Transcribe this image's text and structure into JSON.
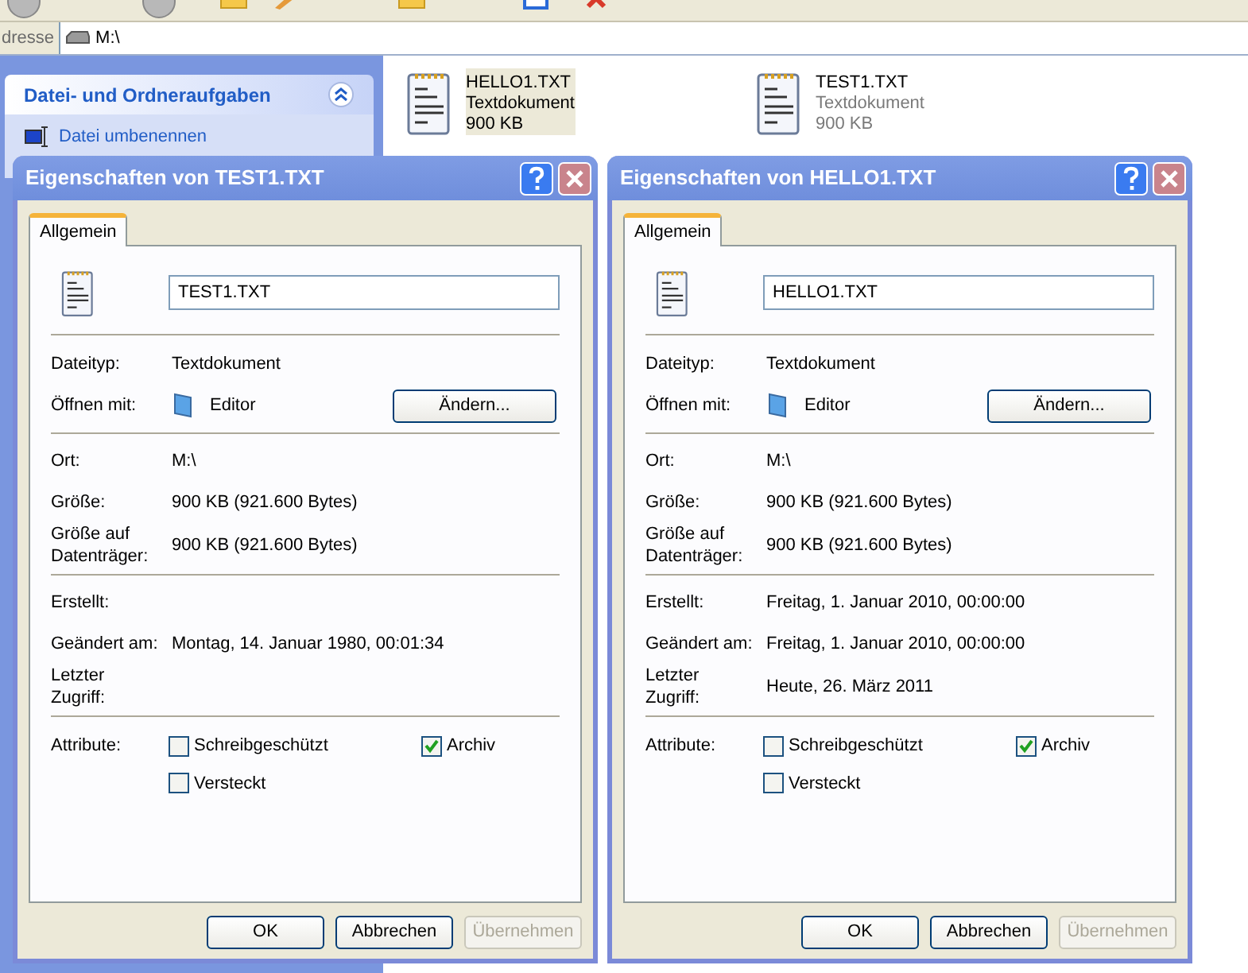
{
  "address_bar": {
    "label": "dresse",
    "value": "M:\\"
  },
  "task_panel": {
    "title": "Datei- und Ordneraufgaben",
    "expanded": true,
    "items": [
      "Datei umbenennen"
    ]
  },
  "files": [
    {
      "name": "HELLO1.TXT",
      "type": "Textdokument",
      "size": "900 KB",
      "selected": true
    },
    {
      "name": "TEST1.TXT",
      "type": "Textdokument",
      "size": "900 KB",
      "selected": false
    }
  ],
  "dialogs": [
    {
      "title": "Eigenschaften von TEST1.TXT",
      "tabs": [
        {
          "label": "Allgemein",
          "selected": true
        }
      ],
      "filename": "TEST1.TXT",
      "sections": [
        [
          {
            "kind": "text",
            "label": "Dateityp:",
            "value": "Textdokument"
          },
          {
            "kind": "app",
            "label": "Öffnen mit:",
            "value": "Editor",
            "button": "Ändern..."
          }
        ],
        [
          {
            "kind": "text",
            "label": "Ort:",
            "value": "M:\\"
          },
          {
            "kind": "text",
            "label": "Größe:",
            "value": "900 KB (921.600 Bytes)"
          },
          {
            "kind": "text",
            "label": "Größe auf\nDatenträger:",
            "value": "900 KB (921.600 Bytes)"
          }
        ],
        [
          {
            "kind": "text",
            "label": "Erstellt:"
          },
          {
            "kind": "text",
            "label": "Geändert am:",
            "value": "Montag, 14. Januar 1980, 00:01:34"
          },
          {
            "kind": "text",
            "label": "Letzter\nZugriff:"
          }
        ]
      ],
      "attributes": {
        "label": "Attribute:",
        "checkboxes": [
          {
            "label": "Schreibgeschützt",
            "checked": false
          },
          {
            "label": "Versteckt",
            "checked": false
          },
          {
            "label": "Archiv",
            "checked": true
          }
        ]
      },
      "buttons": [
        {
          "label": "OK",
          "disabled": false
        },
        {
          "label": "Abbrechen",
          "disabled": false
        },
        {
          "label": "Übernehmen",
          "disabled": true
        }
      ]
    },
    {
      "title": "Eigenschaften von HELLO1.TXT",
      "tabs": [
        {
          "label": "Allgemein",
          "selected": true
        }
      ],
      "filename": "HELLO1.TXT",
      "sections": [
        [
          {
            "kind": "text",
            "label": "Dateityp:",
            "value": "Textdokument"
          },
          {
            "kind": "app",
            "label": "Öffnen mit:",
            "value": "Editor",
            "button": "Ändern..."
          }
        ],
        [
          {
            "kind": "text",
            "label": "Ort:",
            "value": "M:\\"
          },
          {
            "kind": "text",
            "label": "Größe:",
            "value": "900 KB (921.600 Bytes)"
          },
          {
            "kind": "text",
            "label": "Größe auf\nDatenträger:",
            "value": "900 KB (921.600 Bytes)"
          }
        ],
        [
          {
            "kind": "text",
            "label": "Erstellt:",
            "value": "Freitag, 1. Januar 2010, 00:00:00"
          },
          {
            "kind": "text",
            "label": "Geändert am:",
            "value": "Freitag, 1. Januar 2010, 00:00:00"
          },
          {
            "kind": "text",
            "label": "Letzter\nZugriff:",
            "value": "Heute, 26. März 2011"
          }
        ]
      ],
      "attributes": {
        "label": "Attribute:",
        "checkboxes": [
          {
            "label": "Schreibgeschützt",
            "checked": false
          },
          {
            "label": "Versteckt",
            "checked": false
          },
          {
            "label": "Archiv",
            "checked": true
          }
        ]
      },
      "buttons": [
        {
          "label": "OK",
          "disabled": false
        },
        {
          "label": "Abbrechen",
          "disabled": false
        },
        {
          "label": "Übernehmen",
          "disabled": true
        }
      ]
    }
  ]
}
